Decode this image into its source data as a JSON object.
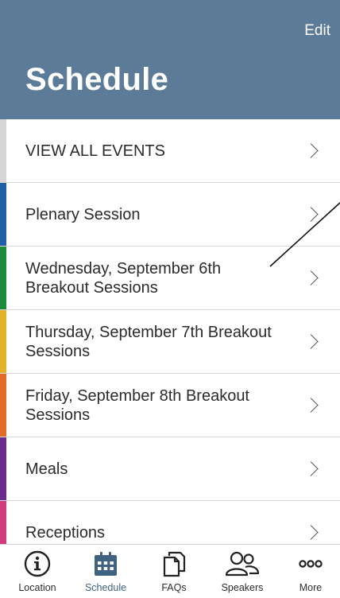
{
  "header": {
    "edit_label": "Edit",
    "title": "Schedule"
  },
  "schedule_items": [
    {
      "label": "VIEW ALL EVENTS",
      "color": "#d6d6d6"
    },
    {
      "label": "Plenary Session",
      "color": "#1f5fa8"
    },
    {
      "label": "Wednesday, September 6th Breakout Sessions",
      "color": "#1e8a3c"
    },
    {
      "label": "Thursday, September 7th Breakout Sessions",
      "color": "#e2b32a"
    },
    {
      "label": "Friday, September 8th Breakout Sessions",
      "color": "#e06a26"
    },
    {
      "label": "Meals",
      "color": "#6a2c8c"
    },
    {
      "label": "Receptions",
      "color": "#d23a7a"
    }
  ],
  "tabbar": {
    "location": "Location",
    "schedule": "Schedule",
    "faqs": "FAQs",
    "speakers": "Speakers",
    "more": "More",
    "active_color": "#3e6280"
  }
}
